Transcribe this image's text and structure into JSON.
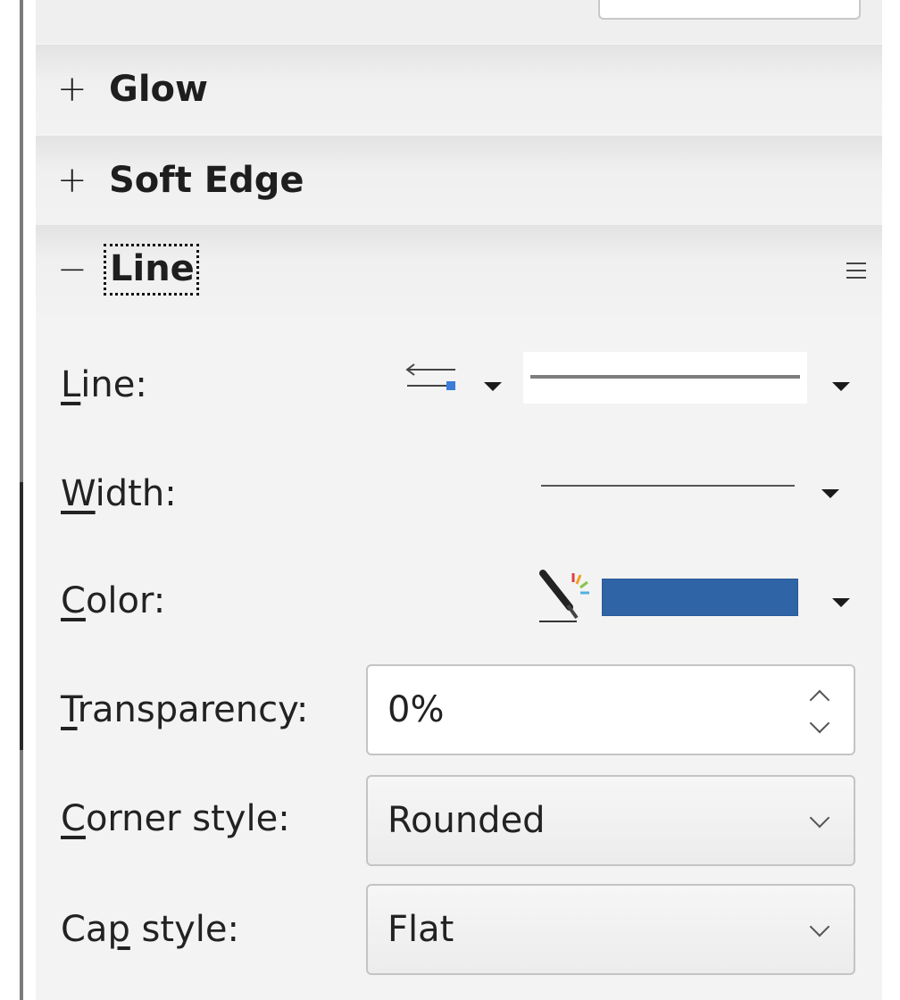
{
  "sections": {
    "glow": {
      "toggle": "+",
      "title": "Glow"
    },
    "soft_edge": {
      "toggle": "+",
      "title": "Soft Edge"
    },
    "line": {
      "toggle": "−",
      "title": "Line"
    }
  },
  "line_props": {
    "line": {
      "label_prefix": "",
      "label_access": "L",
      "label_rest": "ine:"
    },
    "width": {
      "label_prefix": "",
      "label_access": "W",
      "label_rest": "idth:"
    },
    "color": {
      "label_prefix": "",
      "label_access": "C",
      "label_rest": "olor:",
      "value_hex": "#2f64a7"
    },
    "transparency": {
      "label_prefix": "",
      "label_access": "T",
      "label_rest": "ransparency:",
      "value": "0%"
    },
    "corner_style": {
      "label_prefix": "",
      "label_access": "C",
      "label_rest": "orner style:",
      "value": "Rounded"
    },
    "cap_style": {
      "label_prefix": "Ca",
      "label_access": "p",
      "label_rest": " style:",
      "value": "Flat"
    }
  },
  "icons": {
    "arrow_style": "arrow-style-icon",
    "line_style_preview": "line-style-preview",
    "width_preview": "line-width-preview",
    "color_picker": "line-color-icon",
    "section_menu": "more-options-icon"
  }
}
